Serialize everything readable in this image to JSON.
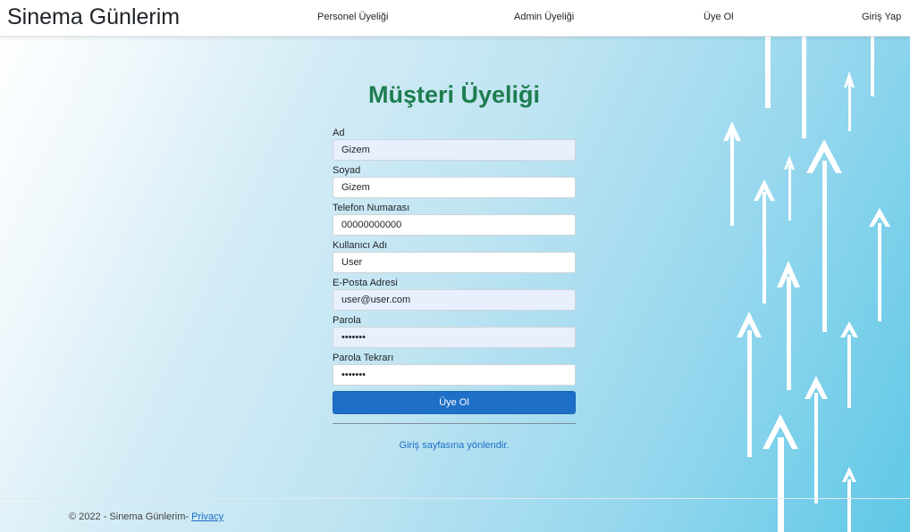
{
  "brand": "Sinema Günlerim",
  "nav": {
    "personnel": "Personel Üyeliği",
    "admin": "Admin Üyeliği",
    "register": "Üye Ol",
    "login": "Giriş Yap"
  },
  "page_title": "Müşteri Üyeliği",
  "form": {
    "fields": [
      {
        "label": "Ad",
        "value": "Gizem"
      },
      {
        "label": "Soyad",
        "value": "Gizem"
      },
      {
        "label": "Telefon Numarası",
        "value": "00000000000"
      },
      {
        "label": "Kullanıcı Adı",
        "value": "User"
      },
      {
        "label": "E-Posta Adresi",
        "value": "user@user.com"
      },
      {
        "label": "Parola",
        "value": "•••••••"
      },
      {
        "label": "Parola Tekrarı",
        "value": "•••••••"
      }
    ],
    "submit_label": "Üye Ol",
    "login_link": "Giriş sayfasına yönlendir."
  },
  "footer": {
    "copyright": "© 2022 - Sinema Günlerim- ",
    "privacy": "Privacy"
  },
  "colors": {
    "title_green": "#1e7d4f",
    "button_blue": "#1d6fc7",
    "autofill_bg": "#e8f0fe",
    "arrow_white": "#ffffff"
  }
}
